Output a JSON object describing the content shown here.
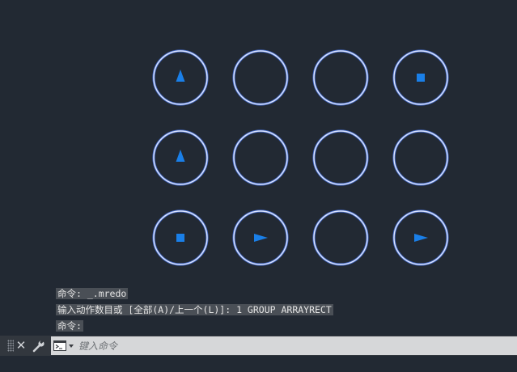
{
  "colors": {
    "canvas_bg": "#222933",
    "circle_stroke": "#dde6ff",
    "circle_glow": "#4a74e0",
    "marker_fill": "#1a7fe8",
    "history_bg": "#4a4f56",
    "input_bg": "#d6d7d9"
  },
  "grid": {
    "rows": [
      [
        "triangle-up",
        "none",
        "none",
        "square"
      ],
      [
        "triangle-up",
        "none",
        "none",
        "none"
      ],
      [
        "square",
        "triangle-right",
        "none",
        "triangle-right"
      ]
    ]
  },
  "command_history": [
    "命令: _.mredo",
    "输入动作数目或 [全部(A)/上一个(L)]: 1 GROUP ARRAYRECT",
    "命令:"
  ],
  "command_line": {
    "placeholder": "键入命令",
    "value": ""
  },
  "icons": {
    "grip": "drag-handle-icon",
    "close": "close-icon",
    "customize": "wrench-icon",
    "prompt": "command-prompt-icon",
    "dropdown": "chevron-down-icon"
  }
}
